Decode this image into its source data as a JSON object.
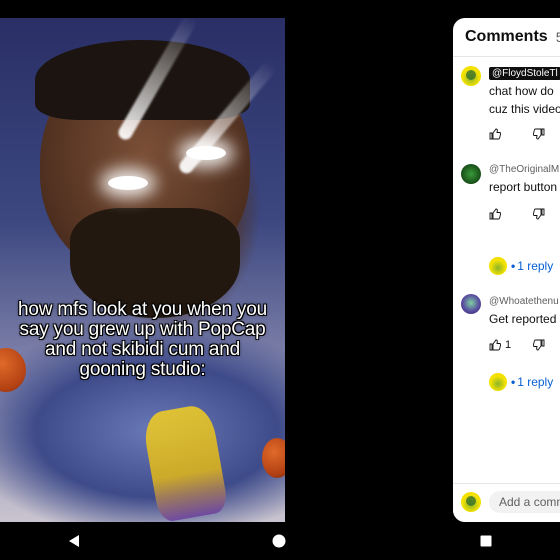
{
  "video": {
    "caption": "how mfs look at you when you say you grew up with PopCap and not skibidi cum and gooning studio:"
  },
  "comments_panel": {
    "title": "Comments",
    "count": "5",
    "comments": [
      {
        "handle": "@FloydStoleTl",
        "handle_highlighted": true,
        "lines": [
          "chat how do",
          "cuz this video"
        ],
        "like_count": "",
        "avatar": "yellow-frog-avatar"
      },
      {
        "handle": "@TheOriginalM",
        "handle_highlighted": false,
        "lines": [
          "report button"
        ],
        "like_count": "",
        "reply_label": "1 reply",
        "avatar": "green-avatar"
      },
      {
        "handle": "@Whoatethenu",
        "handle_highlighted": false,
        "lines": [
          "Get reported"
        ],
        "like_count": "1",
        "reply_label": "1 reply",
        "avatar": "purple-avatar"
      }
    ],
    "add_comment_placeholder": "Add a comm"
  },
  "navbar": {
    "back_icon": "back-triangle-icon",
    "home_icon": "home-circle-icon",
    "recents_icon": "recents-square-icon"
  },
  "colors": {
    "link_blue": "#065fd4",
    "text_primary": "#0f0f0f",
    "text_secondary": "#606060"
  }
}
